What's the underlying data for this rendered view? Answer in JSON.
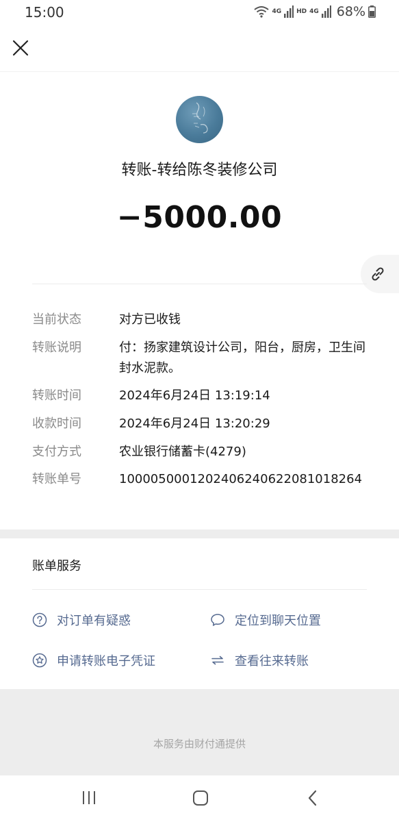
{
  "status_bar": {
    "time": "15:00",
    "network_1": "4G",
    "hd": "HD",
    "network_2": "4G",
    "battery": "68%"
  },
  "header": {
    "close_icon": "close-icon"
  },
  "transfer": {
    "title": "转账-转给陈冬装修公司",
    "amount": "−5000.00"
  },
  "details": [
    {
      "label": "当前状态",
      "value": "对方已收钱"
    },
    {
      "label": "转账说明",
      "value": "付：扬家建筑设计公司，阳台，厨房，卫生间封水泥款。"
    },
    {
      "label": "转账时间",
      "value": "2024年6月24日 13:19:14"
    },
    {
      "label": "收款时间",
      "value": "2024年6月24日 13:20:29"
    },
    {
      "label": "支付方式",
      "value": "农业银行储蓄卡(4279)"
    },
    {
      "label": "转账单号",
      "value": "1000050001202406240622081018264"
    }
  ],
  "services": {
    "title": "账单服务",
    "items": [
      {
        "label": "对订单有疑惑",
        "icon": "question-circle-icon"
      },
      {
        "label": "定位到聊天位置",
        "icon": "chat-bubble-icon"
      },
      {
        "label": "申请转账电子凭证",
        "icon": "star-badge-icon"
      },
      {
        "label": "查看往来转账",
        "icon": "exchange-arrows-icon"
      }
    ]
  },
  "footer": {
    "text": "本服务由财付通提供"
  },
  "colors": {
    "link_blue": "#566a90",
    "label_gray": "#8a8a8a",
    "band_gray": "#ededed"
  }
}
